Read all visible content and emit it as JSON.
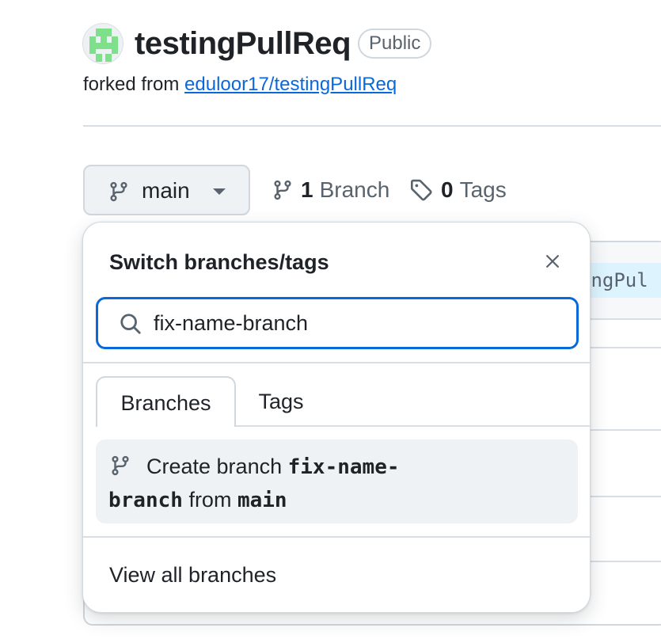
{
  "repo": {
    "name": "testingPullReq",
    "visibility": "Public",
    "forked_prefix": "forked from",
    "forked_source": "eduloor17/testingPullReq"
  },
  "toolbar": {
    "current_branch": "main",
    "branch_count": "1",
    "branch_label": "Branch",
    "tag_count": "0",
    "tag_label": "Tags"
  },
  "background": {
    "chip_text": "ingPul"
  },
  "dropdown": {
    "title": "Switch branches/tags",
    "search_value": "fix-name-branch",
    "tabs": [
      {
        "label": "Branches",
        "active": true
      },
      {
        "label": "Tags",
        "active": false
      }
    ],
    "create": {
      "prefix": "Create branch",
      "branch_name": "fix-name-branch",
      "from_label": "from",
      "source_branch": "main"
    },
    "view_all_label": "View all branches"
  },
  "icons": {
    "avatar": "identicon-avatar",
    "branch": "git-branch-icon",
    "tag": "tag-icon",
    "search": "search-icon",
    "close": "close-icon",
    "caret": "caret-down-icon"
  },
  "colors": {
    "accent": "#0969da",
    "text": "#1f2328",
    "muted": "#59636e",
    "border": "#d0d7de",
    "identicon": "#7ee08a"
  }
}
